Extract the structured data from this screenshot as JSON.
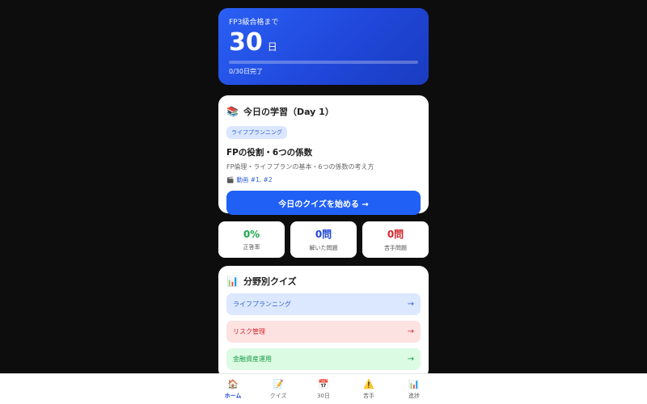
{
  "hero": {
    "label": "FP3級合格まで",
    "days": "30",
    "unit": "日",
    "progress_fraction": 0,
    "progress_text": "0/30日完了"
  },
  "today": {
    "icon": "books-icon",
    "title": "今日の学習（Day 1）",
    "tag": "ライフプランニング",
    "lesson_title": "FPの役割・6つの係数",
    "lesson_desc": "FP倫理・ライフプランの基本・6つの係数の考え方",
    "video_icon": "clapper-icon",
    "video_text": "動画 #1, #2",
    "start_button": "今日のクイズを始める →"
  },
  "stats": [
    {
      "value": "0%",
      "label": "正答率",
      "color": "#1aa84a"
    },
    {
      "value": "0問",
      "label": "解いた問題",
      "color": "#1f46d8"
    },
    {
      "value": "0問",
      "label": "苦手問題",
      "color": "#d8262c"
    }
  ],
  "quiz": {
    "icon": "bar-chart-icon",
    "title": "分野別クイズ",
    "items": [
      {
        "label": "ライフプランニング",
        "arrow": "→",
        "bg": "#dce8ff",
        "fg": "#2f5fd6"
      },
      {
        "label": "リスク管理",
        "arrow": "→",
        "bg": "#fde2e2",
        "fg": "#d8262c"
      },
      {
        "label": "金融資産運用",
        "arrow": "→",
        "bg": "#dcfbe3",
        "fg": "#1a9a44"
      }
    ]
  },
  "nav": [
    {
      "label": "ホーム",
      "icon": "home-icon",
      "active": true
    },
    {
      "label": "クイズ",
      "icon": "pencil-memo-icon",
      "active": false
    },
    {
      "label": "30日",
      "icon": "calendar-icon",
      "active": false
    },
    {
      "label": "苦手",
      "icon": "warning-icon",
      "active": false
    },
    {
      "label": "進捗",
      "icon": "bar-chart-icon",
      "active": false
    }
  ]
}
